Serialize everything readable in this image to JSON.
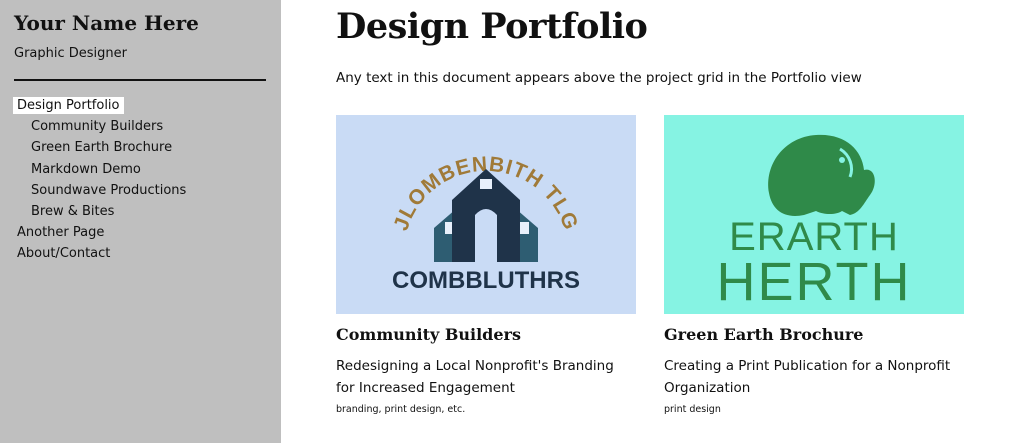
{
  "sidebar": {
    "name": "Your Name Here",
    "role": "Graphic Designer",
    "nav": [
      {
        "label": "Design Portfolio",
        "active": true,
        "sub": false
      },
      {
        "label": "Community Builders",
        "active": false,
        "sub": true
      },
      {
        "label": "Green Earth Brochure",
        "active": false,
        "sub": true
      },
      {
        "label": "Markdown Demo",
        "active": false,
        "sub": true
      },
      {
        "label": "Soundwave Productions",
        "active": false,
        "sub": true
      },
      {
        "label": "Brew & Bites",
        "active": false,
        "sub": true
      },
      {
        "label": "Another Page",
        "active": false,
        "sub": false
      },
      {
        "label": "About/Contact",
        "active": false,
        "sub": false
      }
    ]
  },
  "main": {
    "title": "Design Portfolio",
    "intro": "Any text in this document appears above the project grid in the Portfolio view",
    "cards": [
      {
        "title": "Community Builders",
        "subtitle": "Redesigning a Local Nonprofit's Branding for Increased Engagement",
        "tags": "branding, print design, etc.",
        "image": {
          "arc_text": "JLOMBENBITH TLG",
          "wordmark": "COMBBLUTHRS",
          "bg_color": "#c9dbf5",
          "house_color": "#1f3349",
          "side_house_color": "#2e5d72",
          "arc_color": "#a07a38"
        }
      },
      {
        "title": "Green Earth Brochure",
        "subtitle": "Creating a Print Publication for a Nonprofit Organization",
        "tags": "print design",
        "image": {
          "line1": "ERARTH",
          "line2": "HERTH",
          "bg_color": "#86f3e3",
          "ink_color": "#2f8a49"
        }
      }
    ]
  }
}
